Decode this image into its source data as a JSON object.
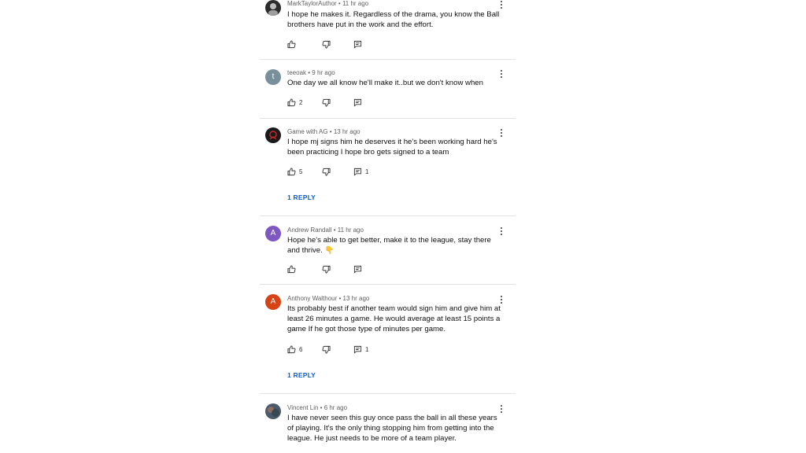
{
  "comments": [
    {
      "author": "MarkTaylorAuthor",
      "time": "11 hr ago",
      "text": "I hope he makes it. Regardless of the drama, you know the Ball brothers have put in the work and the effort.",
      "likes": "",
      "replies_count": "",
      "avatar": {
        "initial": "",
        "color": "#2b2b2b",
        "type": "photo"
      }
    },
    {
      "author": "teeoak",
      "time": "9 hr ago",
      "text": "One day we all know he'll make it..but we don't know when",
      "likes": "2",
      "replies_count": "",
      "avatar": {
        "initial": "t",
        "color": "#78909c",
        "type": "letter"
      }
    },
    {
      "author": "Game with AG",
      "time": "13 hr ago",
      "text": "I hope mj signs him he deserves it he's been working hard he's been practicing I hope bro gets signed to a team",
      "likes": "5",
      "replies_count": "1",
      "reply_link": "1 REPLY",
      "avatar": {
        "initial": "",
        "color": "#1a1a1a",
        "type": "photo"
      }
    },
    {
      "author": "Andrew Randall",
      "time": "11 hr ago",
      "text": "Hope he's able to get better, make it to the league, stay there and thrive. 👇",
      "likes": "",
      "replies_count": "",
      "avatar": {
        "initial": "A",
        "color": "#7e57c2",
        "type": "letter"
      }
    },
    {
      "author": "Anthony Walthour",
      "time": "13 hr ago",
      "text": "Its probably best if another team would sign him and give him at least 26 minutes a game. He would average at least 15 points a game If he got those type of minutes per game.",
      "likes": "6",
      "replies_count": "1",
      "reply_link": "1 REPLY",
      "avatar": {
        "initial": "A",
        "color": "#d84315",
        "type": "letter"
      }
    },
    {
      "author": "Vincent Lin",
      "time": "6 hr ago",
      "text": "I have never seen this guy once pass the ball in all these years of playing. It's the only thing stopping him from getting into the league. He just needs to be more of a team player.",
      "likes": "",
      "replies_count": "",
      "avatar": {
        "initial": "",
        "color": "#4a5a6a",
        "type": "photo"
      }
    }
  ],
  "icons": {
    "like": "thumbs-up-icon",
    "dislike": "thumbs-down-icon",
    "reply": "comment-icon",
    "more": "more-vertical-icon"
  },
  "colors": {
    "meta_text": "#606060",
    "reply_link": "#065fd4",
    "divider": "#e3e3e3"
  }
}
